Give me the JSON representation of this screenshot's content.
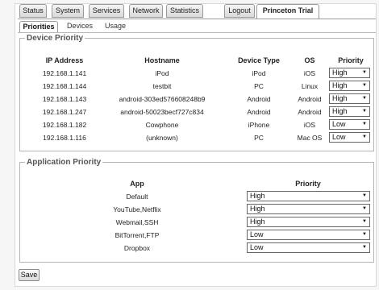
{
  "top_tabs": [
    "Status",
    "System",
    "Services",
    "Network",
    "Statistics",
    "Logout",
    "Princeton Trial"
  ],
  "sub_tabs": [
    "Priorities",
    "Devices",
    "Usage"
  ],
  "device_priority": {
    "title": "Device Priority",
    "headers": [
      "IP Address",
      "Hostname",
      "Device Type",
      "OS",
      "Priority"
    ],
    "rows": [
      {
        "ip": "192.168.1.141",
        "hostname": "iPod",
        "type": "iPod",
        "os": "iOS",
        "priority": "High"
      },
      {
        "ip": "192.168.1.144",
        "hostname": "testbit",
        "type": "PC",
        "os": "Linux",
        "priority": "High"
      },
      {
        "ip": "192.168.1.143",
        "hostname": "android-303ed576608248b9",
        "type": "Android",
        "os": "Android",
        "priority": "High"
      },
      {
        "ip": "192.168.1.247",
        "hostname": "android-50023becf727c834",
        "type": "Android",
        "os": "Android",
        "priority": "High"
      },
      {
        "ip": "192.168.1.182",
        "hostname": "Cowphone",
        "type": "iPhone",
        "os": "iOS",
        "priority": "Low"
      },
      {
        "ip": "192.168.1.116",
        "hostname": "(unknown)",
        "type": "PC",
        "os": "Mac OS",
        "priority": "Low"
      }
    ]
  },
  "application_priority": {
    "title": "Application Priority",
    "headers": [
      "App",
      "Priority"
    ],
    "rows": [
      {
        "app": "Default",
        "priority": "High"
      },
      {
        "app": "YouTube,Netflix",
        "priority": "High"
      },
      {
        "app": "Webmail,SSH",
        "priority": "High"
      },
      {
        "app": "BitTorrent,FTP",
        "priority": "Low"
      },
      {
        "app": "Dropbox",
        "priority": "Low"
      }
    ]
  },
  "save_label": "Save",
  "icons": {
    "dropdown_arrow": "chevron-down-icon"
  }
}
